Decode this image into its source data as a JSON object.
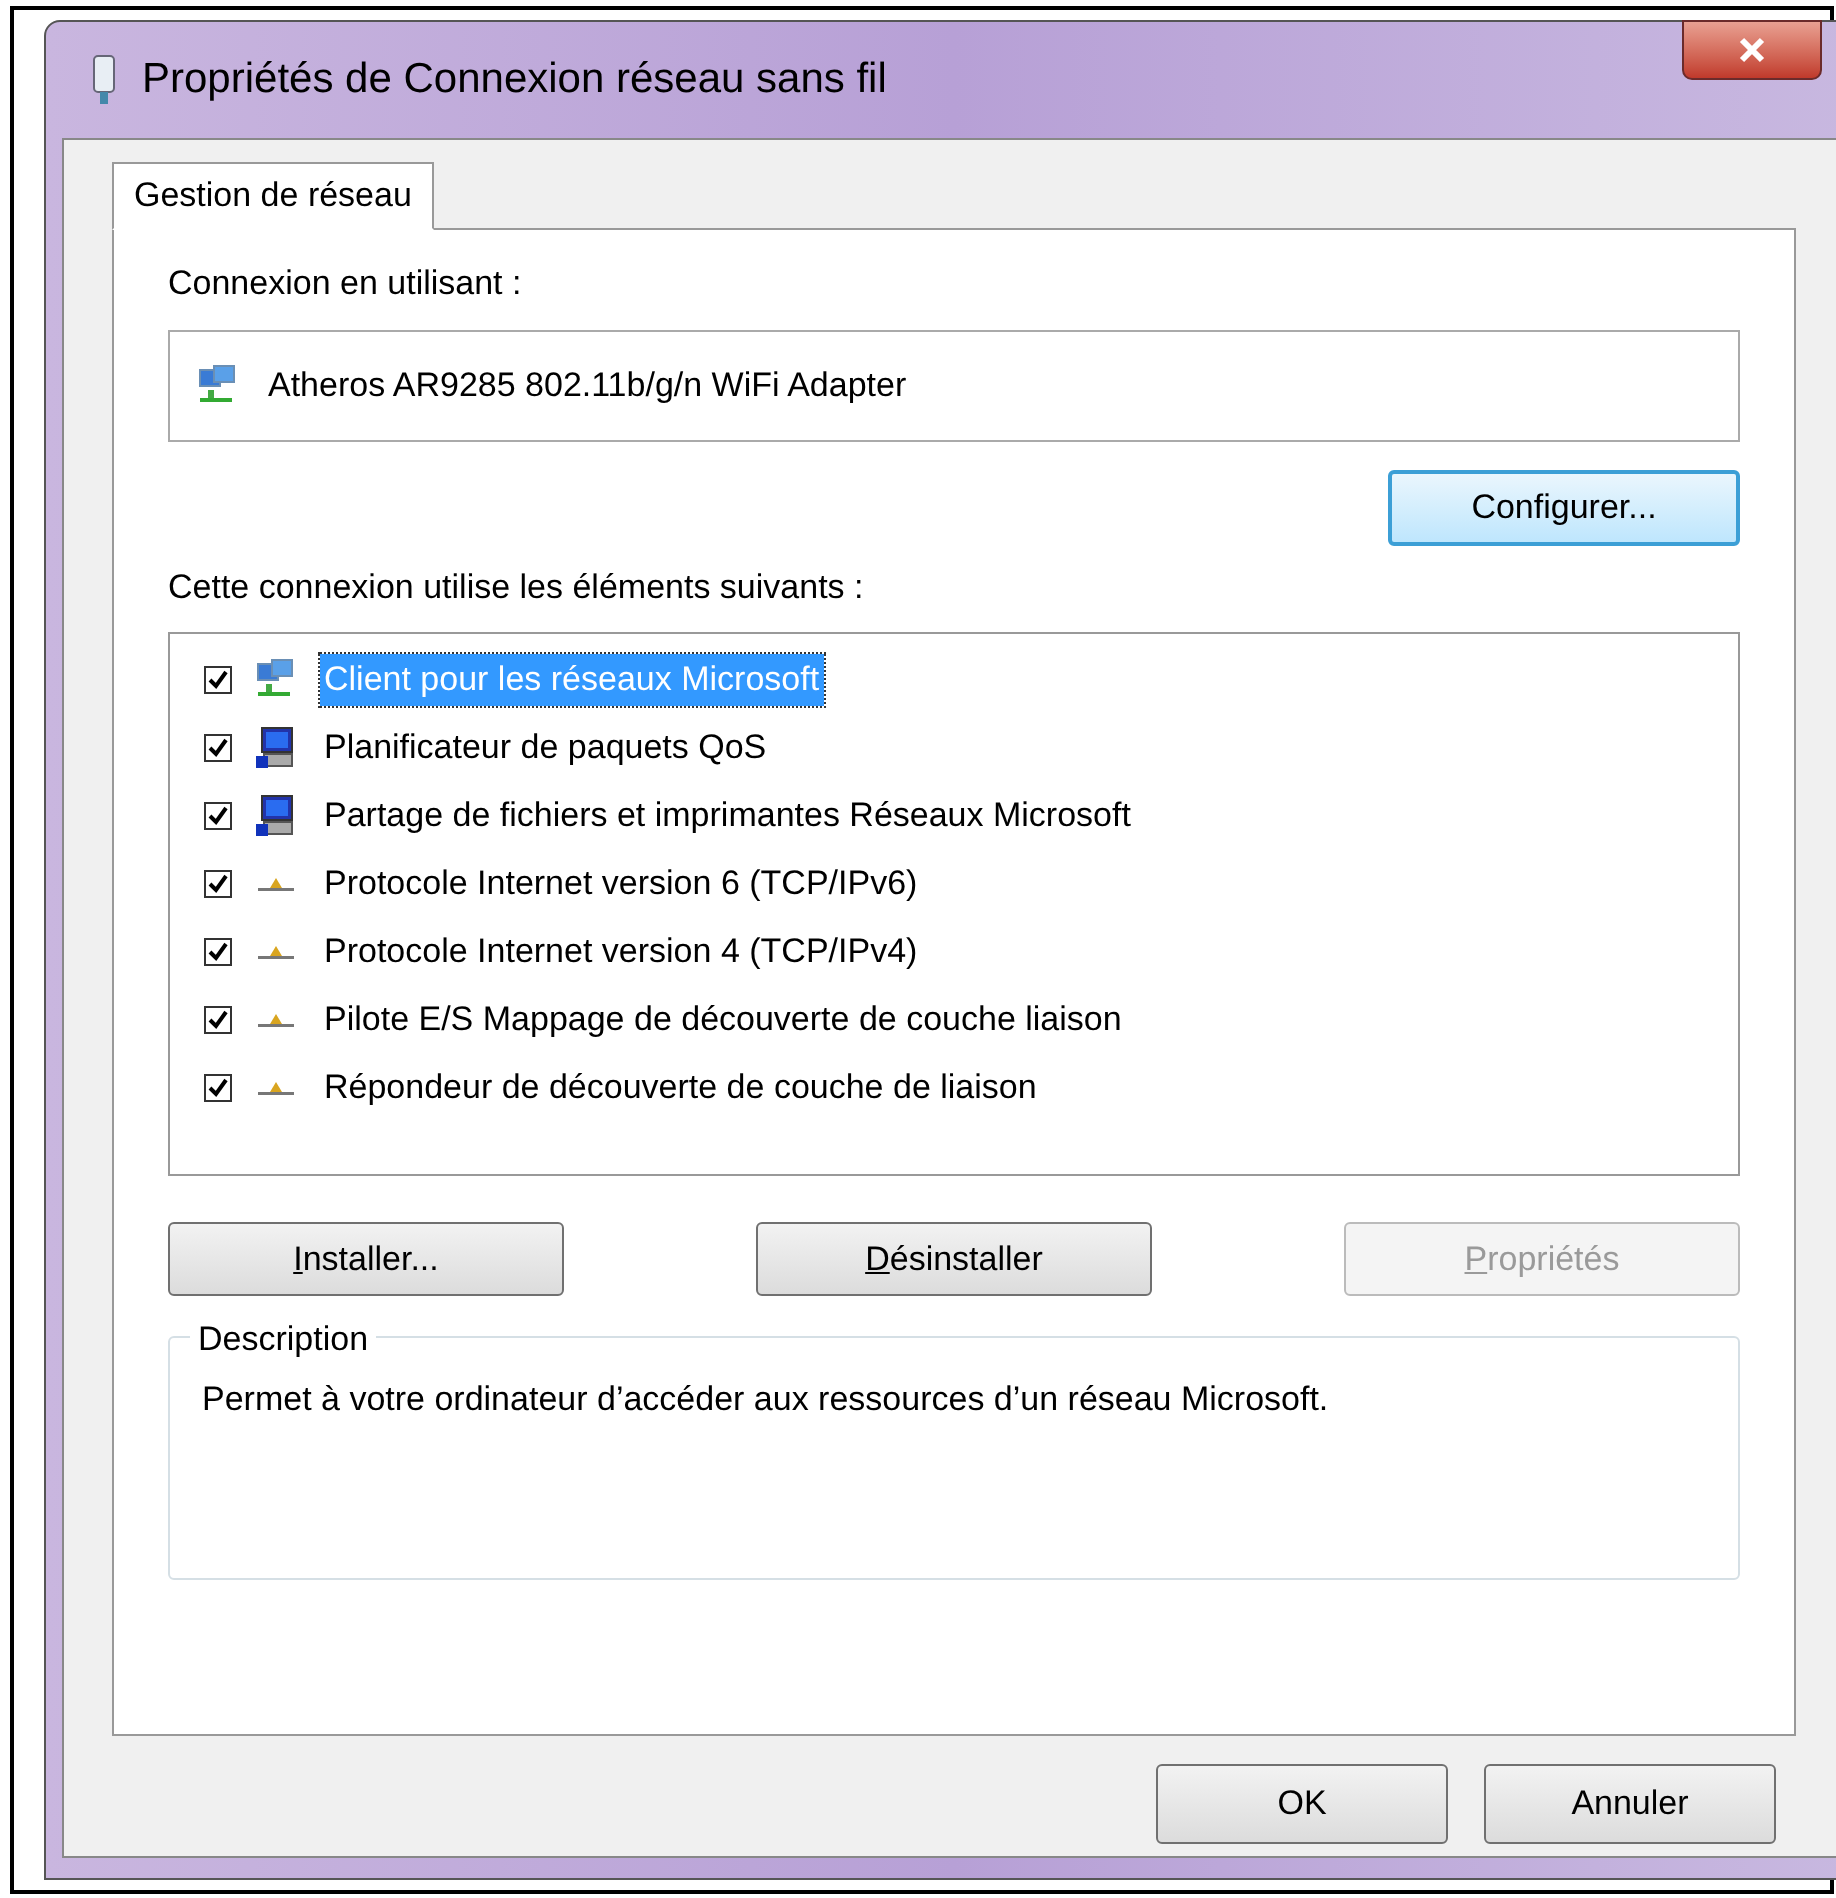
{
  "window": {
    "title": "Propriétés de Connexion réseau sans fil"
  },
  "tabs": [
    {
      "label": "Gestion de réseau",
      "selected": true
    }
  ],
  "connect_using": {
    "label": "Connexion en utilisant :",
    "adapter": "Atheros AR9285 802.11b/g/n WiFi Adapter",
    "configure_button": "Configurer..."
  },
  "items_label": "Cette connexion utilise les éléments suivants :",
  "items": [
    {
      "kind": "client",
      "label": "Client pour les réseaux Microsoft",
      "checked": true,
      "selected": true
    },
    {
      "kind": "service",
      "label": "Planificateur de paquets QoS",
      "checked": true,
      "selected": false
    },
    {
      "kind": "service",
      "label": "Partage de fichiers et imprimantes Réseaux Microsoft",
      "checked": true,
      "selected": false
    },
    {
      "kind": "protocol",
      "label": "Protocole Internet version 6 (TCP/IPv6)",
      "checked": true,
      "selected": false
    },
    {
      "kind": "protocol",
      "label": "Protocole Internet version 4 (TCP/IPv4)",
      "checked": true,
      "selected": false
    },
    {
      "kind": "protocol",
      "label": "Pilote E/S Mappage de découverte de couche liaison",
      "checked": true,
      "selected": false
    },
    {
      "kind": "protocol",
      "label": "Répondeur de découverte de couche de liaison",
      "checked": true,
      "selected": false
    }
  ],
  "item_buttons": [
    {
      "label": "Installer...",
      "disabled": false
    },
    {
      "label": "Désinstaller",
      "disabled": false
    },
    {
      "label": "Propriétés",
      "disabled": true
    }
  ],
  "description": {
    "title": "Description",
    "text": "Permet à votre ordinateur d’accéder aux ressources d’un réseau Microsoft."
  },
  "buttons": [
    "OK",
    "Annuler"
  ]
}
